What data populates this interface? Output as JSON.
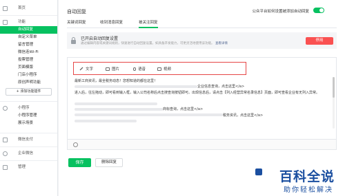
{
  "sidebar": {
    "home": "首页",
    "function_group": "功能",
    "items": [
      {
        "label": "自动回复",
        "active": true
      },
      {
        "label": "自定义菜单"
      },
      {
        "label": "留言管理"
      },
      {
        "label": "微信连Wi-Fi"
      },
      {
        "label": "投票管理"
      },
      {
        "label": "页面模版"
      },
      {
        "label": "门店小程序"
      },
      {
        "label": "原创声明功能"
      }
    ],
    "add_plugin": "+ 添加功能插件",
    "mini_program_group": "小程序",
    "mini_items": [
      {
        "label": "小程序管理"
      },
      {
        "label": "展示场景"
      }
    ],
    "wechat_pay": "微信支付",
    "enterprise": "企业微信",
    "manage": "管理"
  },
  "header": {
    "title": "自动回复",
    "toggle_label": "公众平台如何设置被添加自动回复",
    "toggle_on": true
  },
  "tabs": [
    {
      "label": "关键词回复"
    },
    {
      "label": "收到消息回复"
    },
    {
      "label": "被关注回复",
      "active": true
    }
  ],
  "notice": {
    "title": "已开启自动回复设置",
    "desc": "通过编辑内容或关键词规则，快速进行自动回复设置。如具备开发能力，可更灵活地使用该功能。",
    "link": "查看详情",
    "disable_button": "停用"
  },
  "editor": {
    "toolbar": [
      {
        "label": "文字",
        "icon": "pen-icon"
      },
      {
        "label": "图片",
        "icon": "image-icon"
      },
      {
        "label": "语音",
        "icon": "microphone-icon"
      },
      {
        "label": "视频",
        "icon": "video-icon"
      }
    ],
    "lines": [
      "最新工商资讯，最全税务动态！您想知道的都在这里！",
      "企业信息查询，点击这里</a>",
      "进入后，往左拖动，即可看到输入框，输入公司名称后点击搜查询按钮即可。出现信息后，请点击【列入经营异常名录信息】页面，即可查看企业有无列入异常。",
      "商标查询，点击这里</a>",
      "税务资讯，点击这里</a>"
    ]
  },
  "actions": {
    "save": "保存",
    "delete": "删除回复"
  },
  "watermark": {
    "title": "百科全说",
    "subtitle": "助你轻松解决"
  },
  "colors": {
    "accent": "#07c160",
    "danger": "#fa5151",
    "highlight_border": "#e64545",
    "watermark": "#1b4fa0"
  }
}
